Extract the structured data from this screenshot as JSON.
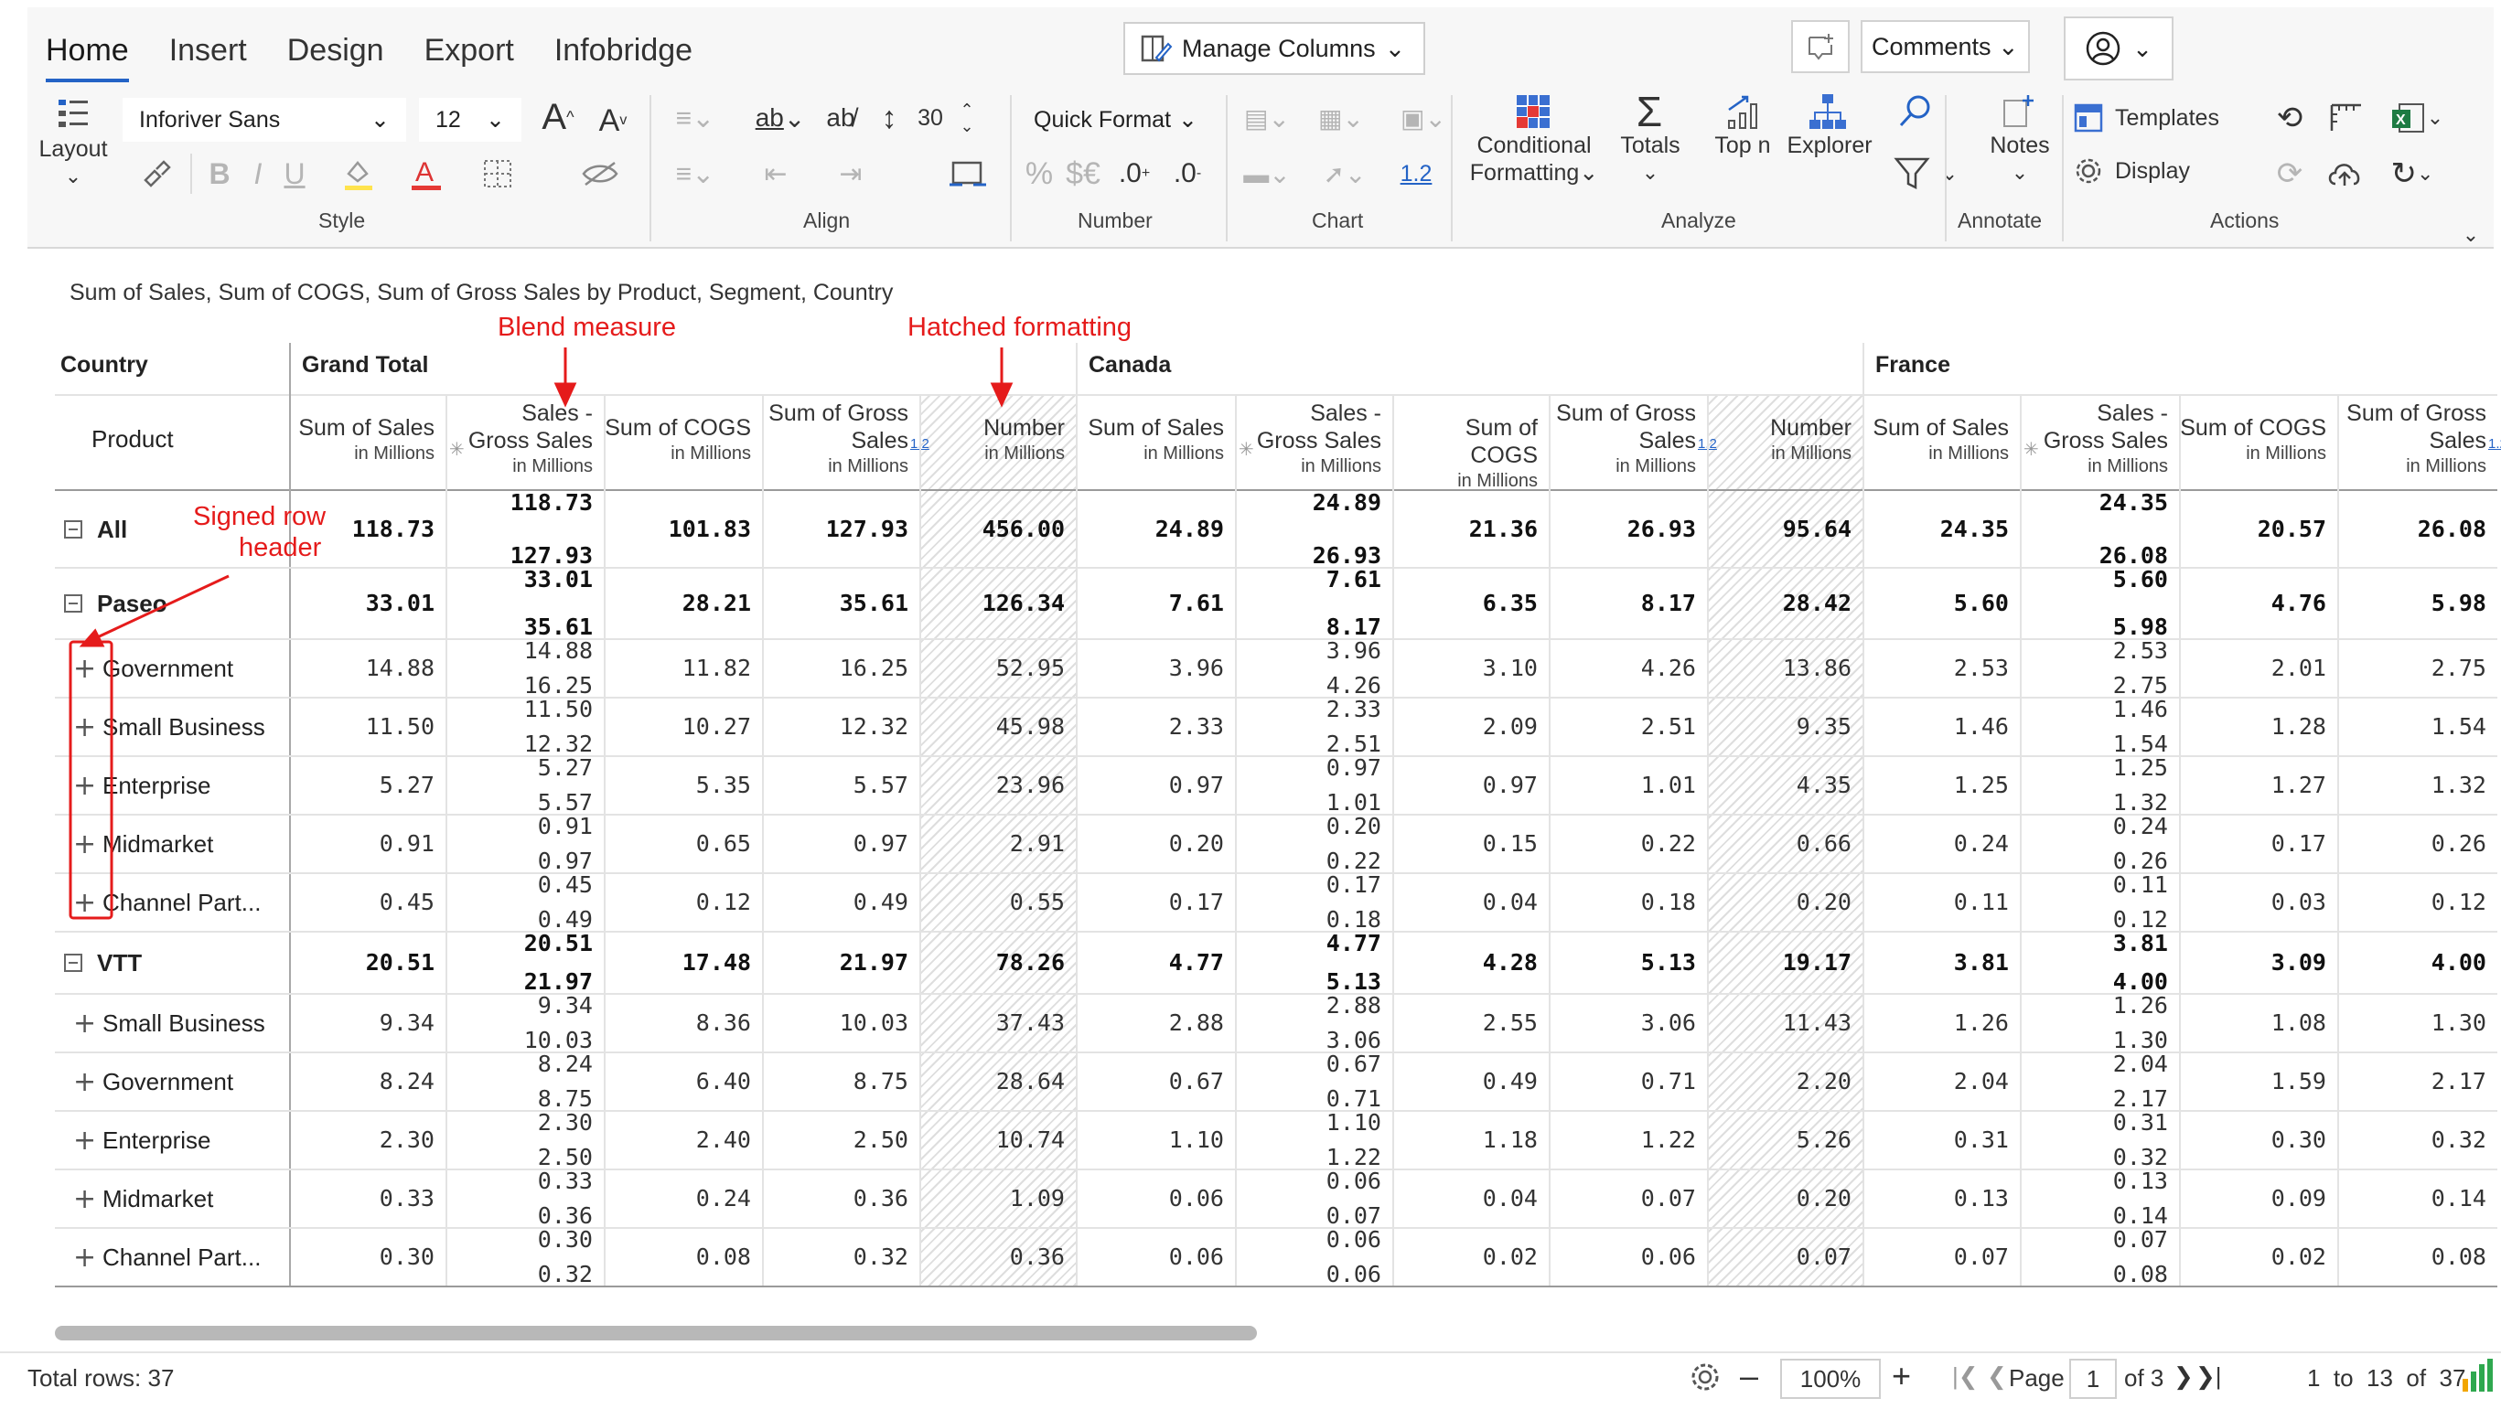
{
  "tabs": [
    {
      "label": "Home",
      "active": true
    },
    {
      "label": "Insert",
      "active": false
    },
    {
      "label": "Design",
      "active": false
    },
    {
      "label": "Export",
      "active": false
    },
    {
      "label": "Infobridge",
      "active": false
    }
  ],
  "toolbar": {
    "manage_columns": "Manage Columns",
    "comments": "Comments",
    "layout": "Layout",
    "font_family": "Inforiver Sans",
    "font_size": "12",
    "row_height": "30",
    "quick_format": "Quick Format",
    "decimal_value": "1.2",
    "conditional_formatting_1": "Conditional",
    "conditional_formatting_2": "Formatting",
    "totals": "Totals",
    "topn": "Top n",
    "explorer": "Explorer",
    "notes": "Notes",
    "templates": "Templates",
    "display": "Display",
    "groups": {
      "style": "Style",
      "align": "Align",
      "number": "Number",
      "chart": "Chart",
      "analyze": "Analyze",
      "annotate": "Annotate",
      "actions": "Actions"
    }
  },
  "report": {
    "title": "Sum of Sales, Sum of COGS, Sum of Gross Sales by Product, Segment, Country",
    "country_header": "Country",
    "product_header": "Product",
    "countries": [
      "Grand Total",
      "Canada",
      "France"
    ],
    "measures": [
      {
        "line1": "Sum of Sales",
        "line2": "",
        "unit": "in Millions",
        "blend": false
      },
      {
        "line1": "Sales -",
        "line2": "Gross Sales",
        "unit": "in Millions",
        "blend": true
      },
      {
        "line1": "Sum of COGS",
        "line2": "",
        "unit": "in Millions",
        "blend": false
      },
      {
        "line1": "Sum of Gross",
        "line2": "Sales",
        "unit": "in Millions",
        "blend": false
      },
      {
        "line1": "Number",
        "line2": "",
        "unit": "in Millions",
        "blend": false
      },
      {
        "line1": "Sum of Sales",
        "line2": "",
        "unit": "in Millions",
        "blend": false
      },
      {
        "line1": "Sales -",
        "line2": "Gross Sales",
        "unit": "in Millions",
        "blend": true
      },
      {
        "line1": "Sum of COGS",
        "line2": "",
        "unit": "in Millions",
        "blend": false
      },
      {
        "line1": "Sum of Gross",
        "line2": "Sales",
        "unit": "in Millions",
        "blend": false
      },
      {
        "line1": "Number",
        "line2": "",
        "unit": "in Millions",
        "blend": false
      },
      {
        "line1": "Sum of Sales",
        "line2": "",
        "unit": "in Millions",
        "blend": false
      },
      {
        "line1": "Sales -",
        "line2": "Gross Sales",
        "unit": "in Millions",
        "blend": true
      },
      {
        "line1": "Sum of COGS",
        "line2": "",
        "unit": "in Millions",
        "blend": false
      },
      {
        "line1": "Sum of Gross",
        "line2": "Sales",
        "unit": "in Millions",
        "blend": false
      }
    ],
    "formula_badge": "1.2",
    "rows": [
      {
        "label": "All",
        "level": 0,
        "bold": true,
        "toggle": "minus",
        "cells": [
          "118.73",
          [
            "118.73",
            "127.93"
          ],
          "101.83",
          "127.93",
          "456.00",
          "24.89",
          [
            "24.89",
            "26.93"
          ],
          "21.36",
          "26.93",
          "95.64",
          "24.35",
          [
            "24.35",
            "26.08"
          ],
          "20.57",
          "26.08"
        ]
      },
      {
        "label": "Paseo",
        "level": 0,
        "bold": true,
        "toggle": "minus",
        "cells": [
          "33.01",
          [
            "33.01",
            "35.61"
          ],
          "28.21",
          "35.61",
          "126.34",
          "7.61",
          [
            "7.61",
            "8.17"
          ],
          "6.35",
          "8.17",
          "28.42",
          "5.60",
          [
            "5.60",
            "5.98"
          ],
          "4.76",
          "5.98"
        ]
      },
      {
        "label": "Government",
        "level": 1,
        "bold": false,
        "toggle": "plus",
        "cells": [
          "14.88",
          [
            "14.88",
            "16.25"
          ],
          "11.82",
          "16.25",
          "52.95",
          "3.96",
          [
            "3.96",
            "4.26"
          ],
          "3.10",
          "4.26",
          "13.86",
          "2.53",
          [
            "2.53",
            "2.75"
          ],
          "2.01",
          "2.75"
        ]
      },
      {
        "label": "Small Business",
        "level": 1,
        "bold": false,
        "toggle": "plus",
        "cells": [
          "11.50",
          [
            "11.50",
            "12.32"
          ],
          "10.27",
          "12.32",
          "45.98",
          "2.33",
          [
            "2.33",
            "2.51"
          ],
          "2.09",
          "2.51",
          "9.35",
          "1.46",
          [
            "1.46",
            "1.54"
          ],
          "1.28",
          "1.54"
        ]
      },
      {
        "label": "Enterprise",
        "level": 1,
        "bold": false,
        "toggle": "plus",
        "cells": [
          "5.27",
          [
            "5.27",
            "5.57"
          ],
          "5.35",
          "5.57",
          "23.96",
          "0.97",
          [
            "0.97",
            "1.01"
          ],
          "0.97",
          "1.01",
          "4.35",
          "1.25",
          [
            "1.25",
            "1.32"
          ],
          "1.27",
          "1.32"
        ]
      },
      {
        "label": "Midmarket",
        "level": 1,
        "bold": false,
        "toggle": "plus",
        "cells": [
          "0.91",
          [
            "0.91",
            "0.97"
          ],
          "0.65",
          "0.97",
          "2.91",
          "0.20",
          [
            "0.20",
            "0.22"
          ],
          "0.15",
          "0.22",
          "0.66",
          "0.24",
          [
            "0.24",
            "0.26"
          ],
          "0.17",
          "0.26"
        ]
      },
      {
        "label": "Channel Part...",
        "level": 1,
        "bold": false,
        "toggle": "plus",
        "cells": [
          "0.45",
          [
            "0.45",
            "0.49"
          ],
          "0.12",
          "0.49",
          "0.55",
          "0.17",
          [
            "0.17",
            "0.18"
          ],
          "0.04",
          "0.18",
          "0.20",
          "0.11",
          [
            "0.11",
            "0.12"
          ],
          "0.03",
          "0.12"
        ]
      },
      {
        "label": "VTT",
        "level": 0,
        "bold": true,
        "toggle": "minus",
        "cells": [
          "20.51",
          [
            "20.51",
            "21.97"
          ],
          "17.48",
          "21.97",
          "78.26",
          "4.77",
          [
            "4.77",
            "5.13"
          ],
          "4.28",
          "5.13",
          "19.17",
          "3.81",
          [
            "3.81",
            "4.00"
          ],
          "3.09",
          "4.00"
        ]
      },
      {
        "label": "Small Business",
        "level": 1,
        "bold": false,
        "toggle": "plus",
        "cells": [
          "9.34",
          [
            "9.34",
            "10.03"
          ],
          "8.36",
          "10.03",
          "37.43",
          "2.88",
          [
            "2.88",
            "3.06"
          ],
          "2.55",
          "3.06",
          "11.43",
          "1.26",
          [
            "1.26",
            "1.30"
          ],
          "1.08",
          "1.30"
        ]
      },
      {
        "label": "Government",
        "level": 1,
        "bold": false,
        "toggle": "plus",
        "cells": [
          "8.24",
          [
            "8.24",
            "8.75"
          ],
          "6.40",
          "8.75",
          "28.64",
          "0.67",
          [
            "0.67",
            "0.71"
          ],
          "0.49",
          "0.71",
          "2.20",
          "2.04",
          [
            "2.04",
            "2.17"
          ],
          "1.59",
          "2.17"
        ]
      },
      {
        "label": "Enterprise",
        "level": 1,
        "bold": false,
        "toggle": "plus",
        "cells": [
          "2.30",
          [
            "2.30",
            "2.50"
          ],
          "2.40",
          "2.50",
          "10.74",
          "1.10",
          [
            "1.10",
            "1.22"
          ],
          "1.18",
          "1.22",
          "5.26",
          "0.31",
          [
            "0.31",
            "0.32"
          ],
          "0.30",
          "0.32"
        ]
      },
      {
        "label": "Midmarket",
        "level": 1,
        "bold": false,
        "toggle": "plus",
        "cells": [
          "0.33",
          [
            "0.33",
            "0.36"
          ],
          "0.24",
          "0.36",
          "1.09",
          "0.06",
          [
            "0.06",
            "0.07"
          ],
          "0.04",
          "0.07",
          "0.20",
          "0.13",
          [
            "0.13",
            "0.14"
          ],
          "0.09",
          "0.14"
        ]
      },
      {
        "label": "Channel Part...",
        "level": 1,
        "bold": false,
        "toggle": "plus",
        "cells": [
          "0.30",
          [
            "0.30",
            "0.32"
          ],
          "0.08",
          "0.32",
          "0.36",
          "0.06",
          [
            "0.06",
            "0.06"
          ],
          "0.02",
          "0.06",
          "0.07",
          "0.07",
          [
            "0.07",
            "0.08"
          ],
          "0.02",
          "0.08"
        ]
      }
    ]
  },
  "annotations": {
    "blend_measure": "Blend measure",
    "hatched_formatting": "Hatched formatting",
    "signed_row_header_1": "Signed row",
    "signed_row_header_2": "header"
  },
  "status": {
    "total_rows": "Total rows: 37",
    "zoom": "100%",
    "page_label": "Page",
    "page_value": "1",
    "page_of": "of 3",
    "range": "1  to  13  of  37"
  },
  "colors": {
    "accent": "#2463c6",
    "annotation": "#e51b1b",
    "bar_green": "#2fa84f",
    "bar_orange": "#f2a600"
  }
}
